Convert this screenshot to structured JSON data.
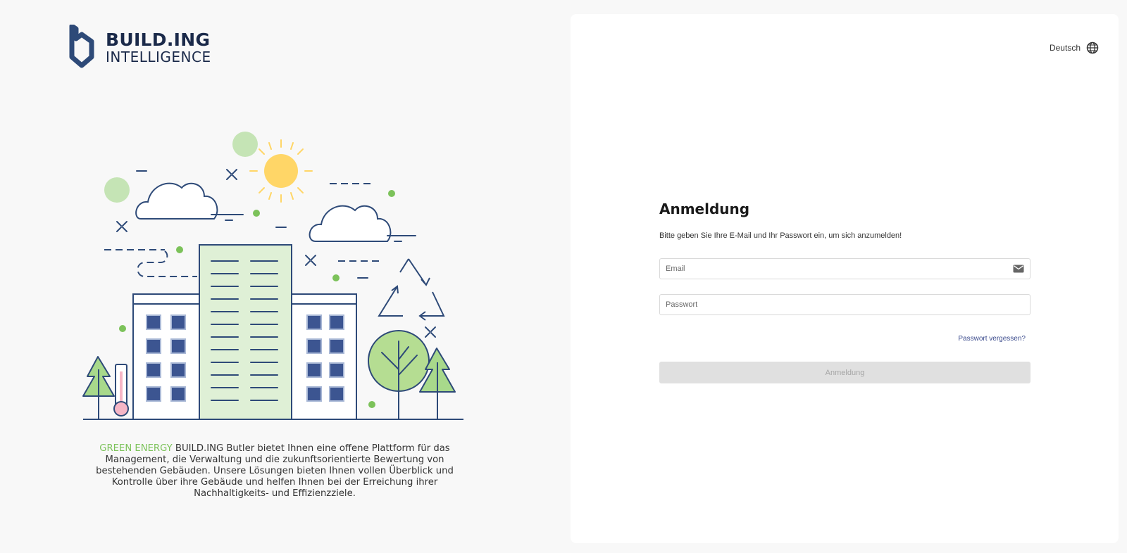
{
  "brand": {
    "name_line1": "BUILD.ING",
    "name_line2": "INTELLIGENCE",
    "color": "#1b2a4a"
  },
  "promo": {
    "accent_text": "GREEN ENERGY",
    "accent_color": "#7cc25a",
    "body_text": " BUILD.ING Butler bietet Ihnen eine offene Plattform für das Management, die Verwaltung und die zukunftsorientierte Bewertung von bestehenden Gebäuden. Unsere Lösungen bieten Ihnen vollen Überblick und Kontrolle über ihre Gebäude und helfen Ihnen bei der Erreichung ihrer Nachhaltigkeits- und Effizienzziele."
  },
  "language": {
    "label": "Deutsch",
    "icon": "globe-icon"
  },
  "login": {
    "title": "Anmeldung",
    "subtitle": "Bitte geben Sie Ihre E-Mail und Ihr Passwort ein, um sich anzumelden!",
    "email_placeholder": "Email",
    "email_icon": "mail-icon",
    "password_placeholder": "Passwort",
    "forgot_label": "Passwort vergessen?",
    "submit_label": "Anmeldung",
    "submit_state": "disabled"
  }
}
